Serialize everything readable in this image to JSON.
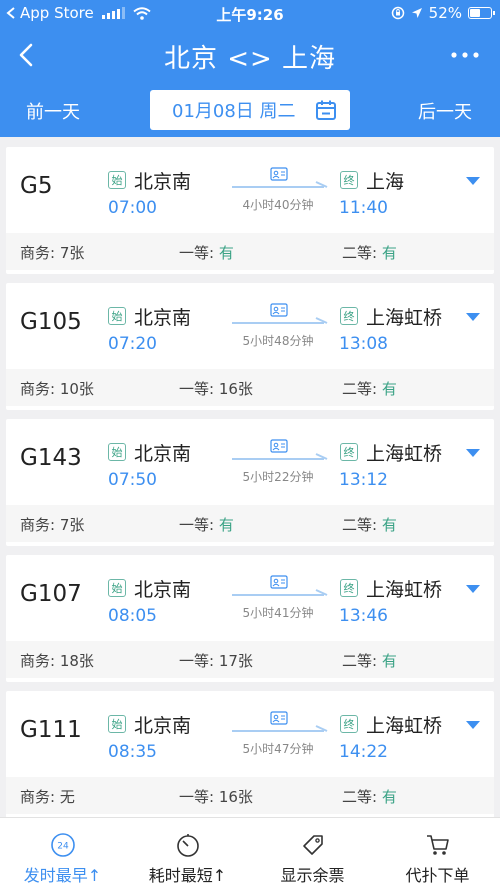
{
  "status_bar": {
    "carrier": "App Store",
    "time": "上午9:26",
    "battery_text": "52%",
    "battery_level": 0.52
  },
  "header": {
    "title": "北京 <> 上海",
    "back_icon": "chevron-left-icon",
    "more_icon": "more-dots-icon"
  },
  "date_bar": {
    "prev_label": "前一天",
    "date_text": "01月08日 周二",
    "next_label": "后一天",
    "calendar_icon": "calendar-icon"
  },
  "trains": [
    {
      "number": "G5",
      "start_badge": "始",
      "from": "北京南",
      "depart": "07:00",
      "duration": "4小时40分钟",
      "end_badge": "终",
      "to": "上海",
      "arrive": "11:40",
      "seats": {
        "business_label": "商务:",
        "business": "7张",
        "first_label": "一等:",
        "first": "有",
        "second_label": "二等:",
        "second": "有"
      }
    },
    {
      "number": "G105",
      "start_badge": "始",
      "from": "北京南",
      "depart": "07:20",
      "duration": "5小时48分钟",
      "end_badge": "终",
      "to": "上海虹桥",
      "arrive": "13:08",
      "seats": {
        "business_label": "商务:",
        "business": "10张",
        "first_label": "一等:",
        "first": "16张",
        "second_label": "二等:",
        "second": "有"
      }
    },
    {
      "number": "G143",
      "start_badge": "始",
      "from": "北京南",
      "depart": "07:50",
      "duration": "5小时22分钟",
      "end_badge": "终",
      "to": "上海虹桥",
      "arrive": "13:12",
      "seats": {
        "business_label": "商务:",
        "business": "7张",
        "first_label": "一等:",
        "first": "有",
        "second_label": "二等:",
        "second": "有"
      }
    },
    {
      "number": "G107",
      "start_badge": "始",
      "from": "北京南",
      "depart": "08:05",
      "duration": "5小时41分钟",
      "end_badge": "终",
      "to": "上海虹桥",
      "arrive": "13:46",
      "seats": {
        "business_label": "商务:",
        "business": "18张",
        "first_label": "一等:",
        "first": "17张",
        "second_label": "二等:",
        "second": "有"
      }
    },
    {
      "number": "G111",
      "start_badge": "始",
      "from": "北京南",
      "depart": "08:35",
      "duration": "5小时47分钟",
      "end_badge": "终",
      "to": "上海虹桥",
      "arrive": "14:22",
      "seats": {
        "business_label": "商务:",
        "business": "无",
        "first_label": "一等:",
        "first": "16张",
        "second_label": "二等:",
        "second": "有"
      }
    }
  ],
  "tabs": [
    {
      "label": "发时最早↑",
      "icon": "clock-24-icon",
      "badge": "24",
      "active": true
    },
    {
      "label": "耗时最短↑",
      "icon": "stopwatch-icon",
      "active": false
    },
    {
      "label": "显示余票",
      "icon": "ticket-tag-icon",
      "active": false
    },
    {
      "label": "代扑下单",
      "icon": "cart-icon",
      "active": false
    }
  ],
  "colors": {
    "primary": "#3d8ff0",
    "available": "#3aa285",
    "background": "#f0f0f2"
  }
}
